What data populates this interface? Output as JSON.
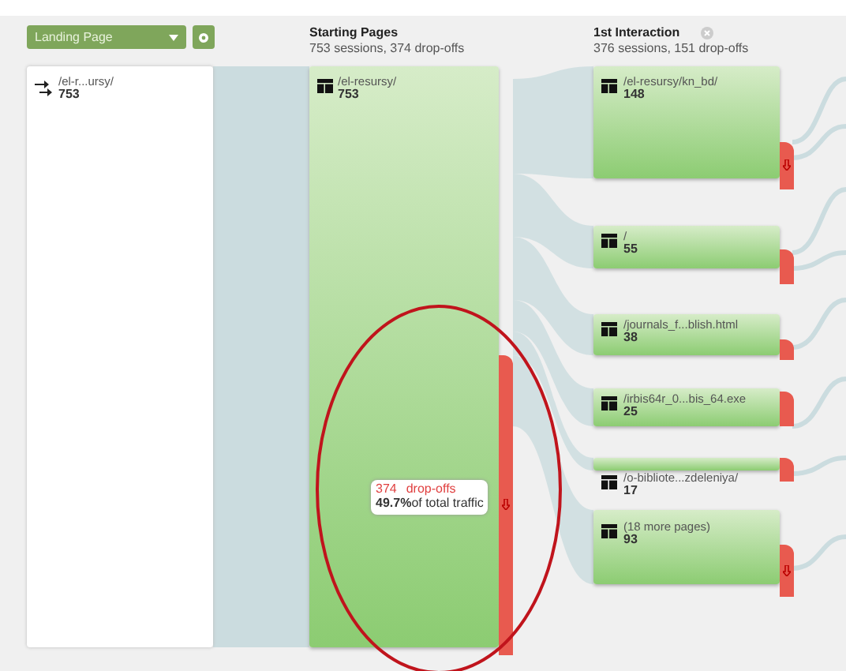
{
  "dimension_select": {
    "value": "Landing Page"
  },
  "columns": [
    {
      "title": "Starting Pages",
      "summary": "753 sessions, 374 drop-offs",
      "closable": false
    },
    {
      "title": "1st Interaction",
      "summary": "376 sessions, 151 drop-offs",
      "closable": true
    }
  ],
  "landing_node": {
    "label": "/el-r...ursy/",
    "count": "753"
  },
  "starting_node": {
    "label": "/el-resursy/",
    "count": "753",
    "dropoff_arrow": true
  },
  "tooltip": {
    "count": "374",
    "label": "drop-offs",
    "percent": "49.7%",
    "suffix": "of total traffic"
  },
  "interaction_nodes": [
    {
      "label": "/el-resursy/kn_bd/",
      "count": "148",
      "dropoff_arrow": true
    },
    {
      "label": "/",
      "count": "55",
      "dropoff_arrow": false
    },
    {
      "label": "/journals_f...blish.html",
      "count": "38",
      "dropoff_arrow": false
    },
    {
      "label": "/irbis64r_0...bis_64.exe",
      "count": "25",
      "dropoff_arrow": false
    },
    {
      "label": "/o-bibliote...zdeleniya/",
      "count": "17",
      "dropoff_arrow": false
    },
    {
      "label": "(18 more pages)",
      "count": "93",
      "dropoff_arrow": true
    }
  ],
  "highlight_ellipse": true
}
